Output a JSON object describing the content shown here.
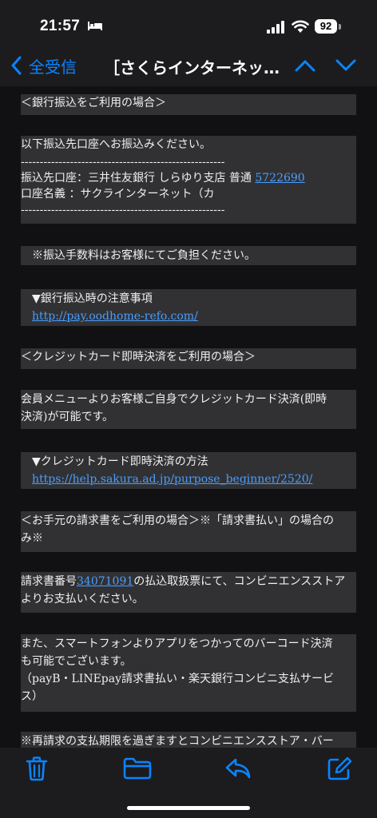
{
  "status_bar": {
    "time": "21:57",
    "battery": "92"
  },
  "nav": {
    "back_label": "全受信",
    "title": "［さくらインターネッ…"
  },
  "email": {
    "bank_heading": "＜銀行振込をご利用の場合＞",
    "bank_intro": "以下振込先口座へお振込みください。",
    "dash_line": "------------------------------------------------------",
    "account_prefix": "振込先口座：三井住友銀行 しらゆり支店 普通 ",
    "account_number": "5722690",
    "account_name": "口座名義 ：サクラインターネット（カ",
    "dash_line2": "------------------------------------------------------",
    "fee_note": "※振込手数料はお客様にてご負担ください。",
    "bank_caution_label": "▼銀行振込時の注意事項",
    "bank_caution_link": "http://pay.oodhome-refo.com/",
    "credit_heading": "＜クレジットカード即時決済をご利用の場合＞",
    "credit_line1": "会員メニューよりお客様ご自身でクレジットカード決済(即時",
    "credit_line2": "決済)が可能です。",
    "credit_method_label": "▼クレジットカード即時決済の方法",
    "credit_method_link": "https://help.sakura.ad.jp/purpose_beginner/2520/",
    "invoice_heading1": "＜お手元の請求書をご利用の場合＞※「請求書払い」の場合の",
    "invoice_heading2": "み※",
    "invoice_prefix": "請求書番号",
    "invoice_number": "34071091",
    "invoice_suffix": "の払込取扱票にて、コンビニエンスストア",
    "invoice_line2": "よりお支払いください。",
    "app_line1": "また、スマートフォンよりアプリをつかってのバーコード決済",
    "app_line2": "も可能でございます。",
    "app_line3": "（payB・LINEpay請求書払い・楽天銀行コンビニ支払サービ",
    "app_line4": "ス）",
    "rebill_line": "※再請求の支払期限を過ぎますとコンビニエンスストア・バー"
  },
  "toolbar": {
    "trash_icon": "trash-icon",
    "folder_icon": "folder-icon",
    "reply_icon": "reply-icon",
    "compose_icon": "compose-icon"
  },
  "colors": {
    "accent": "#0a84ff",
    "link": "#4a9dff",
    "block_bg": "#313133",
    "content_bg": "#111113"
  }
}
